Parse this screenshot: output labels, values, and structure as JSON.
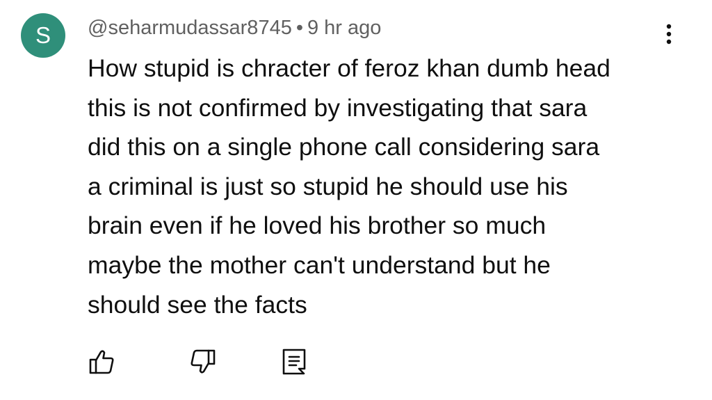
{
  "comment": {
    "avatar_letter": "S",
    "avatar_color": "#2f8f7a",
    "author": "@seharmudassar8745",
    "separator": "•",
    "time": "9 hr ago",
    "text": "How stupid is chracter of feroz khan dumb head\nthis is not confirmed by investigating that sara\ndid this on a single phone call considering sara\na criminal is just so stupid he should use his\nbrain even if he loved his brother so much\nmaybe the mother can't understand but he\nshould see the facts"
  },
  "actions": {
    "like_icon": "thumbs-up-icon",
    "dislike_icon": "thumbs-down-icon",
    "reply_icon": "reply-comment-icon",
    "more_icon": "more-vertical-icon"
  }
}
